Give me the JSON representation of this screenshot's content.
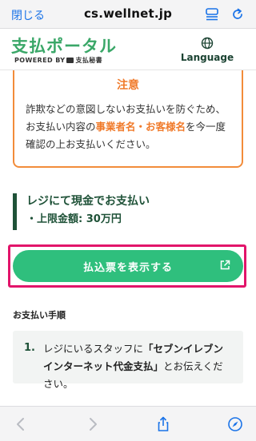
{
  "browser": {
    "close_label": "閉じる",
    "url": "cs.wellnet.jp"
  },
  "header": {
    "logo_text": "支払ポータル",
    "logo_sub": "POWERED BY",
    "logo_sub_brand": "支払秘書",
    "language_label": "Language"
  },
  "notice": {
    "title": "注意",
    "body_pre": "詐欺などの意図しないお支払いを防ぐため、お支払い内容の",
    "body_highlight": "事業者名・お客様名",
    "body_post": "を今一度確認の上お支払いください。"
  },
  "payment": {
    "title": "レジにて現金でお支払い",
    "limit": "・上限金額: 30万円"
  },
  "cta": {
    "label": "払込票を表示する"
  },
  "steps": {
    "heading": "お支払い手順",
    "items": [
      {
        "number": "1.",
        "text_pre": "レジにいるスタッフに",
        "text_bold": "「セブンイレブン インターネット代金支払」",
        "text_post": "とお伝えください。"
      }
    ]
  },
  "colors": {
    "brand_green": "#3aa768",
    "dark_green": "#1f5238",
    "button_green": "#2fbf7d",
    "notice_orange": "#f07a2a",
    "highlight_frame": "#e2146a",
    "link_blue": "#1a73e8"
  },
  "icons": {
    "reader": "reader-icon",
    "reload": "reload-icon",
    "globe": "globe-icon",
    "external": "external-link-icon",
    "back": "back-icon",
    "forward": "forward-icon",
    "share": "share-icon",
    "compass": "compass-icon"
  }
}
